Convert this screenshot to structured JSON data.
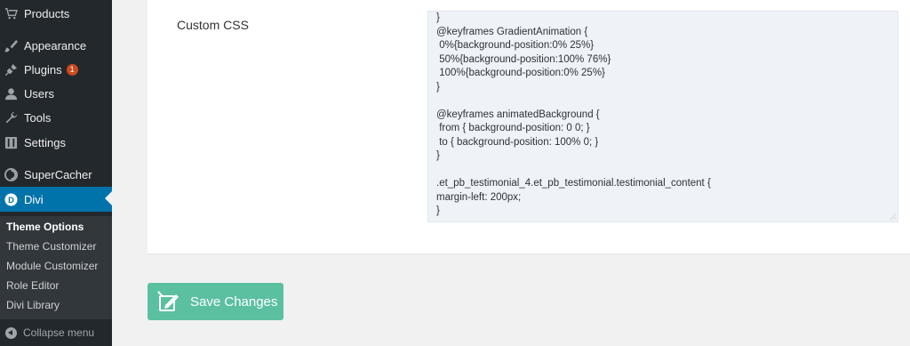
{
  "sidebar": {
    "items": [
      {
        "label": "Products",
        "icon": "cart-icon"
      },
      {
        "label": "Appearance",
        "icon": "paintbrush-icon"
      },
      {
        "label": "Plugins",
        "icon": "plugin-icon",
        "badge": "1"
      },
      {
        "label": "Users",
        "icon": "user-icon"
      },
      {
        "label": "Tools",
        "icon": "wrench-icon"
      },
      {
        "label": "Settings",
        "icon": "settings-icon"
      },
      {
        "label": "SuperCacher",
        "icon": "supercacher-icon"
      },
      {
        "label": "Divi",
        "icon": "divi-icon",
        "current": true
      }
    ],
    "submenu": [
      {
        "label": "Theme Options",
        "active": true
      },
      {
        "label": "Theme Customizer"
      },
      {
        "label": "Module Customizer"
      },
      {
        "label": "Role Editor"
      },
      {
        "label": "Divi Library"
      }
    ],
    "collapse_label": "Collapse menu"
  },
  "main": {
    "custom_css_label": "Custom CSS",
    "code_lines": [
      "}",
      "@keyframes GradientAnimation {",
      " 0%{background-position:0% 25%}",
      " 50%{background-position:100% 76%}",
      " 100%{background-position:0% 25%}",
      "}",
      "",
      "@keyframes animatedBackground {",
      " from { background-position: 0 0; }",
      " to { background-position: 100% 0; }",
      "}",
      "",
      ".et_pb_testimonial_4.et_pb_testimonial.testimonial_content {",
      "margin-left: 200px;",
      "}"
    ],
    "save_button_label": "Save Changes"
  },
  "colors": {
    "sidebar_bg": "#23282d",
    "submenu_bg": "#32373c",
    "current_item_bg": "#0073aa",
    "badge": "#ca4a1f",
    "save_button": "#5bc0a0",
    "editor_bg": "#eff3f8"
  }
}
